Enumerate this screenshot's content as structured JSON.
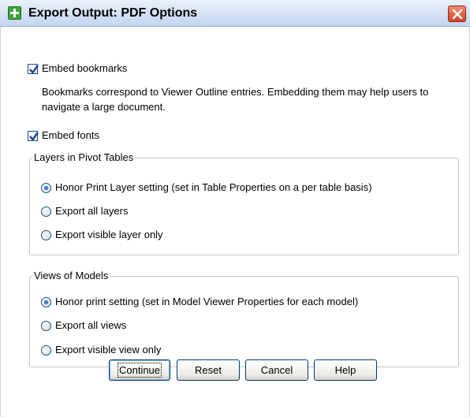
{
  "window": {
    "title": "Export Output: PDF Options"
  },
  "options": {
    "embed_bookmarks_label": "Embed bookmarks",
    "embed_bookmarks_checked": true,
    "bookmarks_description": "Bookmarks correspond to Viewer Outline entries. Embedding them may help users to navigate a large document.",
    "embed_fonts_label": "Embed fonts",
    "embed_fonts_checked": true
  },
  "layers_group": {
    "title": "Layers in Pivot Tables",
    "options": [
      {
        "label": "Honor Print Layer setting (set in Table Properties on a per table basis)",
        "selected": true
      },
      {
        "label": "Export all layers",
        "selected": false
      },
      {
        "label": "Export visible layer only",
        "selected": false
      }
    ]
  },
  "views_group": {
    "title": "Views of Models",
    "options": [
      {
        "label": "Honor print setting (set in Model Viewer Properties for each model)",
        "selected": true
      },
      {
        "label": "Export all views",
        "selected": false
      },
      {
        "label": "Export visible view only",
        "selected": false
      }
    ]
  },
  "buttons": {
    "continue": "Continue",
    "reset": "Reset",
    "cancel": "Cancel",
    "help": "Help"
  },
  "colors": {
    "titlebar": "#d6e3f5",
    "close_button": "#d5472a",
    "button_border": "#003c74",
    "check_mark": "#1f3f9e",
    "radio_dot": "#3d7fd1"
  },
  "icons": {
    "app_icon": "green-plus-icon",
    "close_icon": "close-x-icon"
  }
}
